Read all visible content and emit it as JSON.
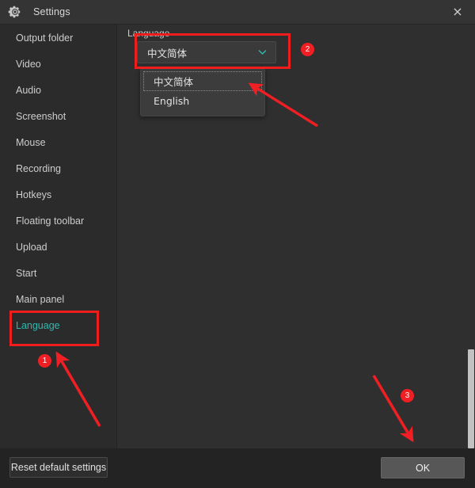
{
  "window": {
    "title": "Settings",
    "gear_icon": "gear-icon",
    "close_label": "×"
  },
  "sidebar": {
    "items": [
      {
        "label": "Output folder",
        "active": false
      },
      {
        "label": "Video",
        "active": false
      },
      {
        "label": "Audio",
        "active": false
      },
      {
        "label": "Screenshot",
        "active": false
      },
      {
        "label": "Mouse",
        "active": false
      },
      {
        "label": "Recording",
        "active": false
      },
      {
        "label": "Hotkeys",
        "active": false
      },
      {
        "label": "Floating toolbar",
        "active": false
      },
      {
        "label": "Upload",
        "active": false
      },
      {
        "label": "Start",
        "active": false
      },
      {
        "label": "Main panel",
        "active": false
      },
      {
        "label": "Language",
        "active": true
      }
    ]
  },
  "content": {
    "field_label": "Language",
    "combo": {
      "selected_value": "中文简体",
      "chevron_icon": "chevron-down-icon",
      "chevron_color": "#2fb8b0"
    },
    "dropdown": {
      "open": true,
      "options": [
        {
          "label": "中文简体",
          "focused": true
        },
        {
          "label": "English",
          "focused": false
        }
      ]
    }
  },
  "footer": {
    "reset_label": "Reset default settings",
    "ok_label": "OK"
  },
  "annotations": {
    "accent_color": "#ef1f24",
    "badges": [
      {
        "number": "1",
        "target": "sidebar-item-language"
      },
      {
        "number": "2",
        "target": "language-combobox"
      },
      {
        "number": "3",
        "target": "ok-button"
      }
    ],
    "boxes": [
      {
        "target": "language-combobox"
      },
      {
        "target": "sidebar-item-language"
      }
    ],
    "arrows": [
      {
        "from": "badge-1",
        "to": "sidebar-item-language"
      },
      {
        "from": "badge-2",
        "to": "dropdown-option-0"
      },
      {
        "from": "badge-3",
        "to": "ok-button"
      }
    ]
  },
  "scrollbar": {
    "orientation": "vertical",
    "thumb_color": "#c2c2c2"
  }
}
